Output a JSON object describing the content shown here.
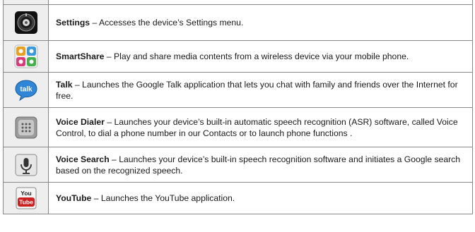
{
  "apps": [
    {
      "key": "settings",
      "icon": "settings-icon",
      "name": "Settings",
      "separator": " – ",
      "description": "Accesses the device’s Settings menu."
    },
    {
      "key": "smartshare",
      "icon": "smartshare-icon",
      "name": "SmartShare",
      "separator": " – ",
      "description": "Play and share media contents from a wireless device via your mobile phone."
    },
    {
      "key": "talk",
      "icon": "talk-icon",
      "name": "Talk",
      "separator": " – ",
      "description": "Launches the Google Talk application that lets you chat with family and friends over the Internet for free."
    },
    {
      "key": "voice-dialer",
      "icon": "voice-dialer-icon",
      "name": "Voice Dialer",
      "separator": " – ",
      "description": "Launches your device’s built-in automatic speech recognition (ASR) software, called Voice Control, to dial a phone number in our Contacts or to launch phone functions ."
    },
    {
      "key": "voice-search",
      "icon": "microphone-icon",
      "name": "Voice Search",
      "separator": " – ",
      "description": "Launches your device’s built-in speech recognition software and initiates a Google search based on the recognized speech."
    },
    {
      "key": "youtube",
      "icon": "youtube-icon",
      "name": "YouTube",
      "separator": " – ",
      "description": "Launches the YouTube application."
    }
  ],
  "icon_labels": {
    "talk": "talk",
    "youtube_top": "You",
    "youtube_bottom": "Tube"
  },
  "colors": {
    "border": "#888888",
    "icon_cell_bg": "#eeeeee",
    "talk_blue": "#2f86d6",
    "youtube_red": "#cc1f1f"
  }
}
